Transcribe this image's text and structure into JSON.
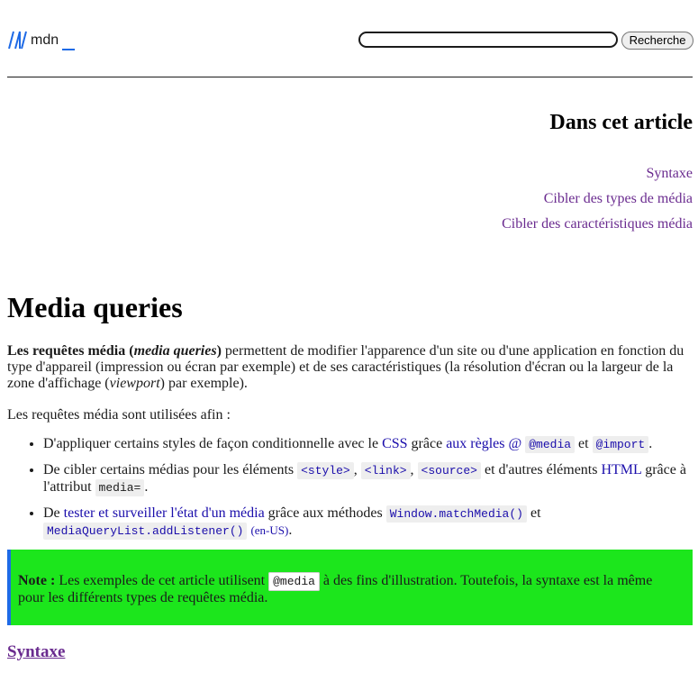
{
  "header": {
    "logo_text": "mdn",
    "search_placeholder": "",
    "search_button": "Recherche"
  },
  "toc": {
    "title": "Dans cet article",
    "items": [
      "Syntaxe",
      "Cibler des types de média",
      "Cibler des caractéristiques média"
    ]
  },
  "article": {
    "title": "Media queries",
    "intro": {
      "strong_1": "Les requêtes média (",
      "strong_em": "media queries",
      "strong_2": ")",
      "text_1": " permettent de modifier l'apparence d'un site ou d'une application en fonction du type d'appareil (impression ou écran par exemple) et de ses caractéristiques (la résolution d'écran ou la largeur de la zone d'affichage (",
      "em": "viewport",
      "text_2": ") par exemple)."
    },
    "used_for": "Les requêtes média sont utilisées afin :",
    "list": {
      "item1": {
        "t1": "D'appliquer certains styles de façon conditionnelle avec le ",
        "link_css": "CSS",
        "t2": " grâce ",
        "link_rules": "aux règles @",
        "code_media": "@media",
        "t3": " et ",
        "code_import": "@import",
        "t4": "."
      },
      "item2": {
        "t1": "De cibler certains médias pour les éléments ",
        "code_style": "<style>",
        "sep1": ", ",
        "code_link": "<link>",
        "sep2": ", ",
        "code_source": "<source>",
        "t2": " et d'autres éléments ",
        "link_html": "HTML",
        "t3": " grâce à l'attribut ",
        "code_media_attr": "media=",
        "t4": "."
      },
      "item3": {
        "t1": "De ",
        "link_test": "tester et surveiller l'état d'un média",
        "t2": " grâce aux méthodes ",
        "code_matchmedia": "Window.matchMedia()",
        "t3": " et ",
        "code_addlistener": "MediaQueryList.addListener()",
        "enus": "(en-US)",
        "t4": "."
      }
    },
    "note": {
      "label": "Note :",
      "t1": " Les exemples de cet article utilisent ",
      "code": "@media",
      "t2": " à des fins d'illustration. Toutefois, la syntaxe est la même pour les différents types de requêtes média."
    },
    "section_heading": "Syntaxe"
  },
  "colors": {
    "link": "#1a0dab",
    "visited": "#6a2b8f",
    "note_bg": "#1ce61c",
    "note_border": "#1e6ae6",
    "logo_blue": "#1e6ae6"
  }
}
